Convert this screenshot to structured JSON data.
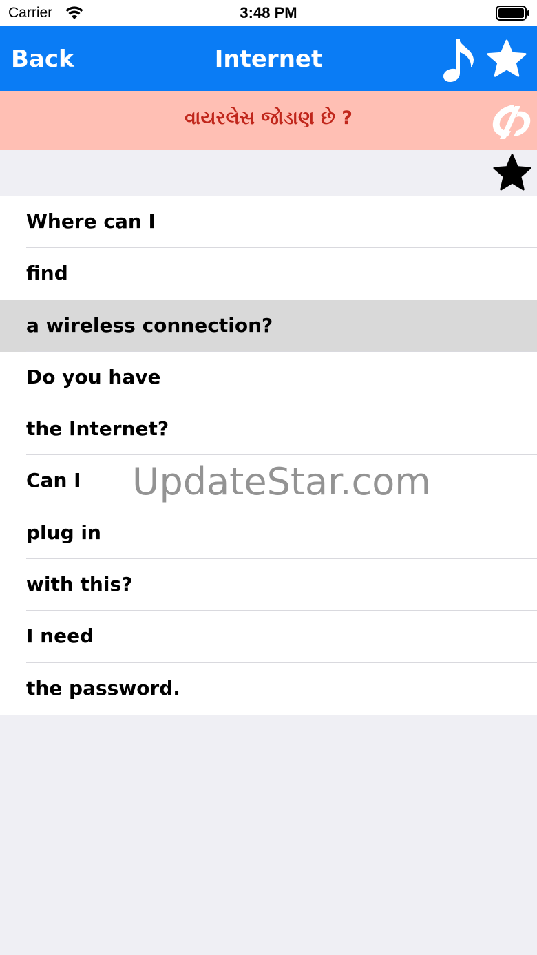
{
  "status_bar": {
    "carrier": "Carrier",
    "time": "3:48 PM",
    "wifi_icon": "wifi-icon",
    "battery_icon": "battery-icon"
  },
  "nav": {
    "back_label": "Back",
    "title": "Internet",
    "music_icon": "music-note-icon",
    "favorite_icon": "star-icon",
    "bar_color": "#0a7cf5"
  },
  "translation": {
    "text": "વાયરલેસ જોડાણ છે ?",
    "text_color": "#c0261b",
    "background": "#ffbfb4",
    "logo_icon": "app-logo-icon"
  },
  "favorite_strip": {
    "icon": "star-icon"
  },
  "phrases": [
    {
      "label": "Where can I"
    },
    {
      "label": "find"
    },
    {
      "label": "a wireless connection?",
      "selected": true
    },
    {
      "label": "Do you have"
    },
    {
      "label": "the Internet?"
    },
    {
      "label": "Can I"
    },
    {
      "label": "plug in"
    },
    {
      "label": "with this?"
    },
    {
      "label": "I need"
    },
    {
      "label": "the password."
    }
  ],
  "watermark": "UpdateStar.com"
}
